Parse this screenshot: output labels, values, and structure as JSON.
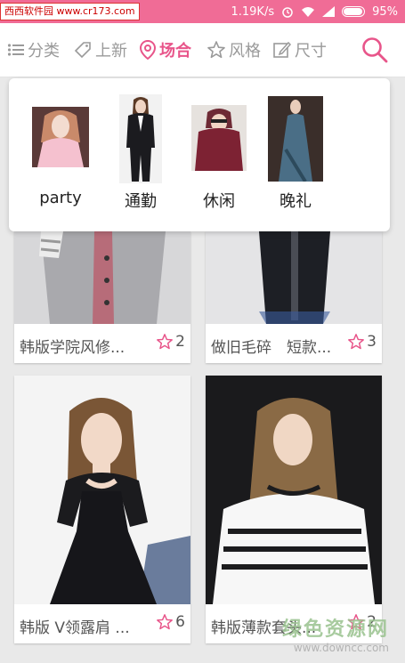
{
  "status_bar": {
    "watermark": "西西软件园 www.cr173.com",
    "speed": "1.19K/s",
    "battery": "95%"
  },
  "tabs": [
    {
      "label": "分类",
      "icon": "list-icon"
    },
    {
      "label": "上新",
      "icon": "new-tag-icon"
    },
    {
      "label": "场合",
      "icon": "location-pin-icon",
      "active": true
    },
    {
      "label": "风格",
      "icon": "star-outline-icon"
    },
    {
      "label": "尺寸",
      "icon": "edit-icon"
    }
  ],
  "dropdown": {
    "options": [
      {
        "label": "party"
      },
      {
        "label": "通勤"
      },
      {
        "label": "休闲"
      },
      {
        "label": "晚礼"
      }
    ]
  },
  "products": [
    {
      "name": "韩版学院风修...",
      "favs": "2"
    },
    {
      "name": "做旧毛碎　短款...",
      "favs": "3"
    },
    {
      "name": "韩版 V领露肩 ...",
      "favs": "6"
    },
    {
      "name": "韩版薄款套头...",
      "favs": "2"
    }
  ],
  "watermark": {
    "line1": "绿色资源网",
    "line2": "www.downcc.com"
  },
  "colors": {
    "accent": "#e8558a",
    "status_bar": "#f06c96"
  }
}
